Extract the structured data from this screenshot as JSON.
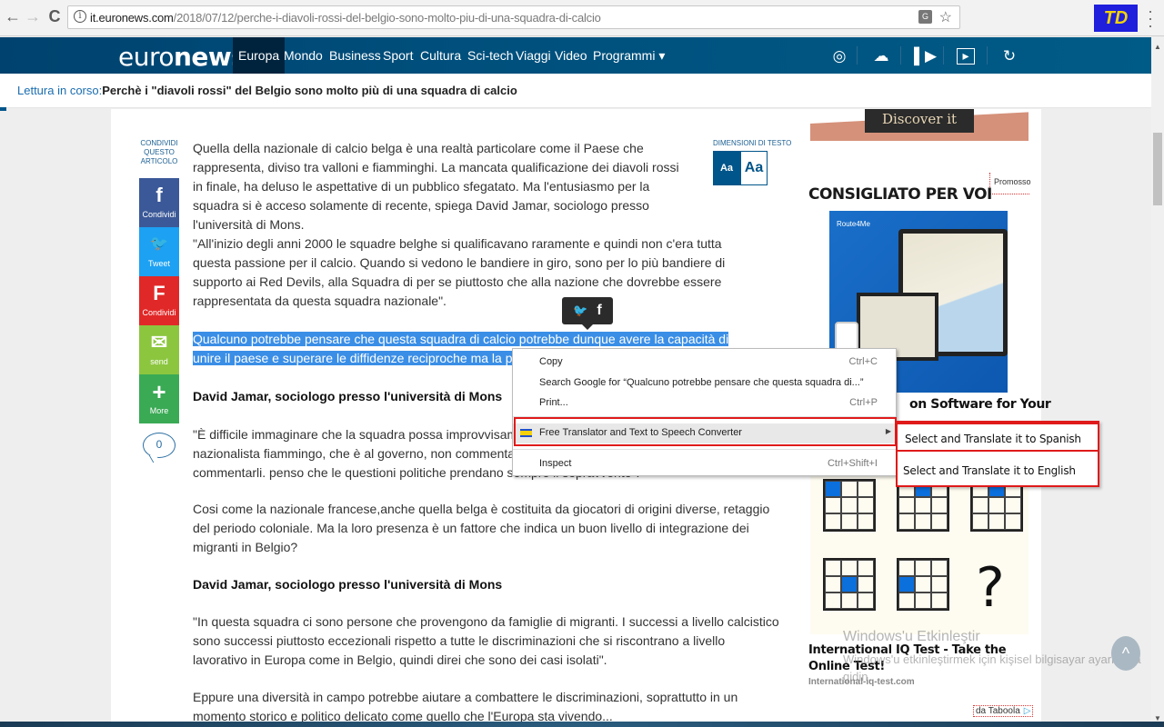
{
  "browser": {
    "url_host": "it.euronews.com",
    "url_path": "/2018/07/12/perche-i-diavoli-rossi-del-belgio-sono-molto-piu-di-una-squadra-di-calcio",
    "extension_label": "TD",
    "icons": {
      "back": "←",
      "forward": "→",
      "reload": "C",
      "info": "i",
      "translate": "G",
      "star": "☆",
      "menu": "⋮"
    }
  },
  "site_nav": {
    "logo_light": "euro",
    "logo_bold": "news.",
    "items": [
      {
        "label": "Europa",
        "active": true
      },
      {
        "label": "Mondo"
      },
      {
        "label": "Business"
      },
      {
        "label": "Sport"
      },
      {
        "label": "Cultura"
      },
      {
        "label": "Sci-tech"
      },
      {
        "label": "Viaggi"
      },
      {
        "label": "Video"
      },
      {
        "label": "Programmi ▾"
      }
    ],
    "icons": [
      "globe-icon",
      "weather-icon",
      "live-icon",
      "play-icon",
      "history-icon"
    ]
  },
  "reading_bar": {
    "prefix": "Lettura in corso:",
    "title": "Perchè i \"diavoli rossi\" del Belgio sono molto più di una squadra di calcio"
  },
  "share": {
    "label": "CONDIVIDI QUESTO ARTICOLO",
    "buttons": [
      {
        "icon": "f",
        "label": "Condividi",
        "color": "#3b5998"
      },
      {
        "icon": "🐦",
        "label": "Tweet",
        "color": "#1da1f2"
      },
      {
        "icon": "F",
        "label": "Condividi",
        "color": "#e12828"
      },
      {
        "icon": "✉",
        "label": "send",
        "color": "#8cc63f"
      },
      {
        "icon": "+",
        "label": "More",
        "color": "#3aaa55"
      }
    ],
    "comments_count": "0"
  },
  "text_size": {
    "label": "DIMENSIONI DI TESTO",
    "small": "Aa",
    "large": "Aa"
  },
  "article": {
    "paragraphs": [
      "Quella della nazionale di calcio belga è una realtà particolare come il Paese che rappresenta, diviso tra valloni e fiamminghi. La mancata qualificazione dei diavoli rossi in finale, ha deluso le aspettative di un pubblico sfegatato. Ma l'entusiasmo per la squadra si è acceso solamente di recente, spiega David Jamar, sociologo presso l'università di Mons.",
      "\"All'inizio degli anni 2000 le squadre belghe si qualificavano raramente e quindi non c'era tutta questa passione per il calcio. Quando si vedono le bandiere in giro, sono per lo più bandiere di supporto ai Red Devils, alla Squadra di per se piuttosto che alla nazione che dovrebbe essere rappresentata da questa squadra nazionale\".",
      "Qualcuno potrebbe pensare che questa squadra di calcio potrebbe dunque avere la capacità di unire il paese e superare le diffidenze reciproche ma la politica sem",
      "David Jamar, sociologo presso l'università di Mons",
      "\"È difficile immaginare che la squadra possa improvvisame nazionalista fiammingo, che è al governo, non commenta q commentarli. penso che le questioni politiche prendano sempre il sopravvento\".",
      "Cosi come la nazionale francese,anche quella belga è costituita da giocatori di origini diverse, retaggio del periodo coloniale. Ma la loro presenza è un fattore che indica un buon livello di integrazione dei migranti in Belgio?",
      "David Jamar, sociologo presso l'università di Mons",
      "\"In questa squadra ci sono persone che provengono da famiglie di migranti. I successi a livello calcistico sono successi piuttosto eccezionali rispetto a tutte le discriminazioni che si riscontrano a livello lavorativo in Europa come in Belgio, quindi direi che sono dei casi isolati\".",
      "Eppure una diversità in campo potrebbe aiutare a combattere le discriminazioni, soprattutto in un momento storico e politico delicato come quello che l'Europa sta vivendo..."
    ],
    "selected_text": "Qualcuno potrebbe pensare che questa squadra di calcio potrebbe dunque avere la capacità di unire il paese e superare le diffidenze reciproche ma la politica sem"
  },
  "selection_share": {
    "twitter": "🐦",
    "facebook": "f"
  },
  "context_menu": {
    "items": [
      {
        "label": "Copy",
        "shortcut": "Ctrl+C"
      },
      {
        "label": "Search Google for “Qualcuno potrebbe pensare che questa squadra di...”",
        "shortcut": ""
      },
      {
        "label": "Print...",
        "shortcut": "Ctrl+P"
      },
      {
        "label": "Free Translator and Text to Speech Converter",
        "shortcut": "",
        "submenu": true,
        "highlighted": true
      },
      {
        "label": "Inspect",
        "shortcut": "Ctrl+Shift+I"
      }
    ],
    "submenu": [
      {
        "label": "Select and Translate it to Spanish",
        "selected": true
      },
      {
        "label": "Select and Translate it to English"
      }
    ]
  },
  "sidebar": {
    "top_ad_label": "Discover it",
    "promo_label": "Promosso",
    "reco_title": "CONSIGLIATO PER VOI",
    "ad1_brand": "Route4Me",
    "ad1_caption": "on Software for Your",
    "ad2_title": "International IQ Test - Take the Online Test!",
    "ad2_source": "International-iq-test.com",
    "ad2_question": "?",
    "taboola_label": "da Taboola"
  },
  "watermark": {
    "line1": "Windows'u Etkinleştir",
    "line2": "Windows'u etkinleştirmek için kişisel bilgisayar ayarlarına",
    "line3": "gidin."
  },
  "scroll_top_icon": "^"
}
